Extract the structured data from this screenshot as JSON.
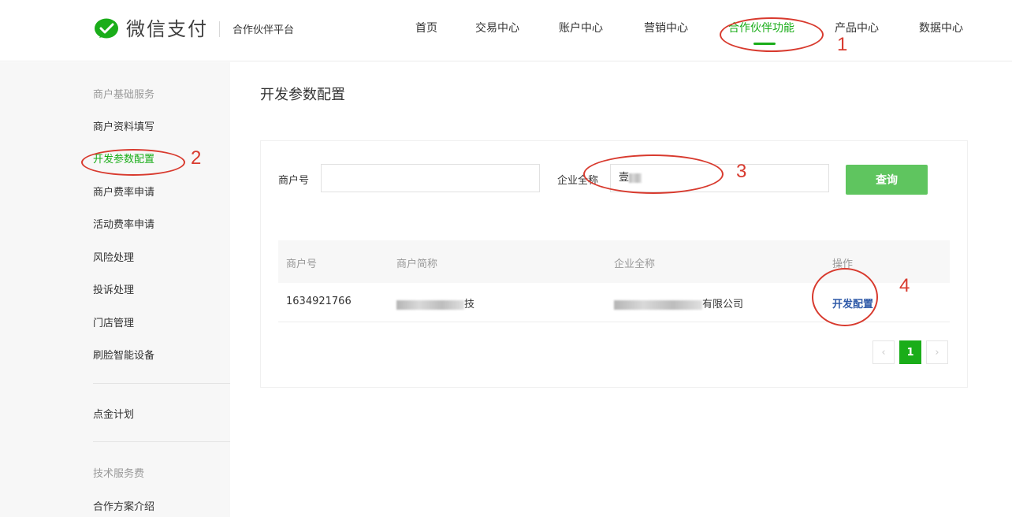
{
  "header": {
    "logo_text": "微信支付",
    "logo_sub": "合作伙伴平台",
    "nav": [
      "首页",
      "交易中心",
      "账户中心",
      "营销中心",
      "合作伙伴功能",
      "产品中心",
      "数据中心"
    ],
    "active_nav": "合作伙伴功能"
  },
  "sidebar": {
    "heading_basic": "商户基础服务",
    "items_basic": [
      "商户资料填写",
      "开发参数配置",
      "商户费率申请",
      "活动费率申请",
      "风险处理",
      "投诉处理",
      "门店管理",
      "刷脸智能设备"
    ],
    "active_item": "开发参数配置",
    "item_gold": "点金计划",
    "heading_tech": "技术服务费",
    "item_plan": "合作方案介绍"
  },
  "main": {
    "title": "开发参数配置",
    "search": {
      "merchant_id_label": "商户号",
      "merchant_id_value": "",
      "company_label": "企业全称",
      "company_value": "壹",
      "query_button": "查询"
    },
    "table": {
      "columns": [
        "商户号",
        "商户简称",
        "企业全称",
        "操作"
      ],
      "rows": [
        {
          "merchant_id": "1634921766",
          "short_name_visible": "技",
          "company_visible": "有限公司",
          "action": "开发配置"
        }
      ]
    },
    "pagination": {
      "prev": "‹",
      "current": "1",
      "next": "›"
    }
  },
  "annotations": [
    "1",
    "2",
    "3",
    "4"
  ],
  "colors": {
    "brand_green": "#1aad19",
    "button_green": "#5fc55f",
    "link_blue": "#2f5aa8",
    "annotation_red": "#d83a2e"
  }
}
